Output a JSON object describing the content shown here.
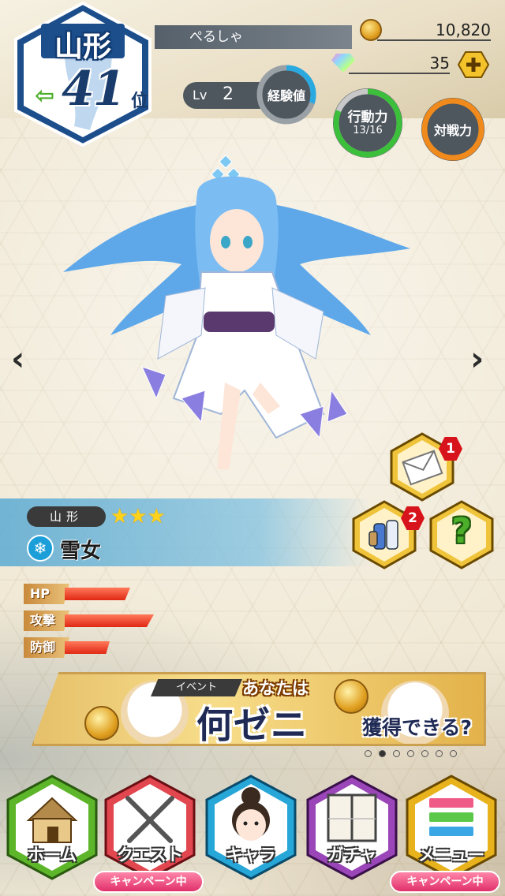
{
  "header": {
    "prefecture": "山形",
    "rank_number": "41",
    "rank_unit": "位",
    "rank_change": "up",
    "player_name": "ぺるしゃ",
    "coins": "10,820",
    "gems": "35",
    "level_label": "Lv",
    "level": "2",
    "exp_label": "経験値",
    "stamina_label": "行動力",
    "stamina_value": "13/16",
    "stamina_fraction": 0.8125,
    "battle_label": "対戦力"
  },
  "character": {
    "prefecture": "山形",
    "rarity_stars": 3,
    "stars_text": "★★★",
    "element_icon": "snowflake-icon",
    "name": "雪女",
    "stats": [
      {
        "label": "HP",
        "fill": 0.55
      },
      {
        "label": "攻撃",
        "fill": 0.75
      },
      {
        "label": "防御",
        "fill": 0.38
      }
    ]
  },
  "side_buttons": {
    "mail_badge": "1",
    "items_badge": "2",
    "help_symbol": "?"
  },
  "banner": {
    "tag": "イベント",
    "line1": "あなたは",
    "line2": "何ゼニ",
    "line3": "獲得できる?",
    "page_index": 1,
    "page_count": 7
  },
  "nav": [
    {
      "label": "ホーム",
      "icon": "house-icon",
      "color": "#5db62a"
    },
    {
      "label": "クエスト",
      "icon": "crossed-swords-icon",
      "color": "#e2474f"
    },
    {
      "label": "キャラ",
      "icon": "girl-face-icon",
      "color": "#27a6d8"
    },
    {
      "label": "ガチャ",
      "icon": "sliding-door-icon",
      "color": "#9a46b8"
    },
    {
      "label": "メニュー",
      "icon": "menu-icon",
      "color": "#e7b21c"
    }
  ],
  "campaign_tags": [
    "キャンペーン中",
    "キャンペーン中"
  ],
  "colors": {
    "accent_blue": "#1c4e8c",
    "stamina_ring": "#3cbf3a",
    "battle_ring": "#f08a1c"
  }
}
